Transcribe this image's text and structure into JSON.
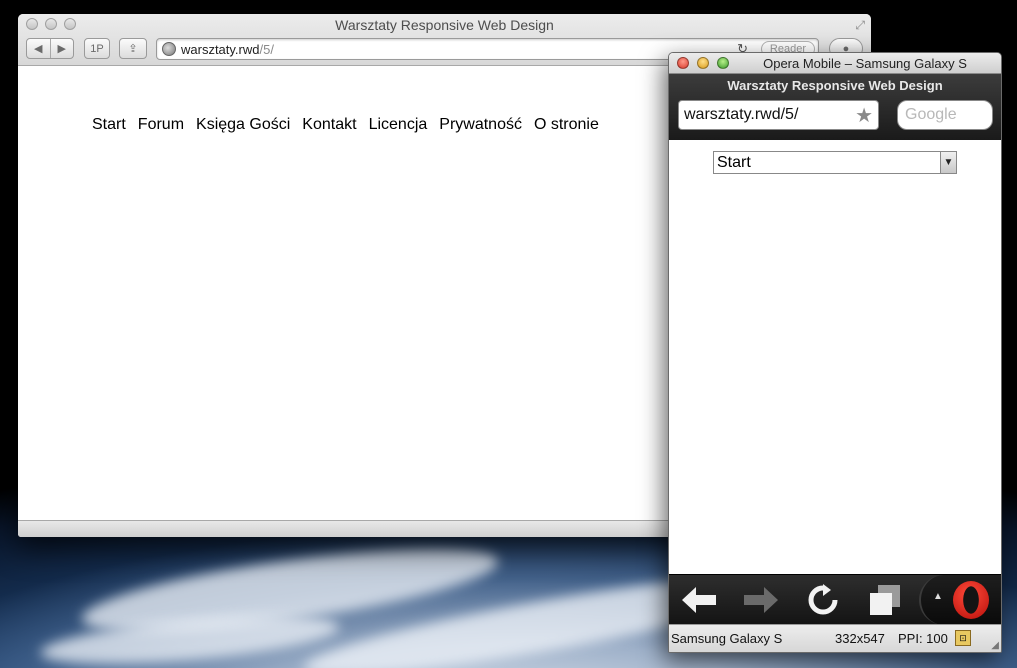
{
  "desktop": {
    "wallpaper": "earth-from-orbit"
  },
  "safari": {
    "title": "Warsztaty Responsive Web Design",
    "toolbar": {
      "back_icon": "back-arrow-icon",
      "forward_icon": "forward-arrow-icon",
      "onepassword_label": "1P",
      "share_icon": "share-icon",
      "address_host": "warsztaty.rwd",
      "address_path": "/5/",
      "reload_icon": "reload-icon",
      "reader_label": "Reader"
    },
    "nav_items": [
      "Start",
      "Forum",
      "Księga Gości",
      "Kontakt",
      "Licencja",
      "Prywatność",
      "O stronie"
    ]
  },
  "opera_mobile": {
    "window_title": "Opera Mobile – Samsung Galaxy S",
    "page_title": "Warsztaty Responsive Web Design",
    "address": "warsztaty.rwd/5/",
    "search_placeholder": "Google",
    "nav_select_value": "Start",
    "toolbar": {
      "back_icon": "back-arrow-icon",
      "forward_icon": "forward-arrow-icon",
      "reload_icon": "reload-icon",
      "tabs_icon": "tabs-icon",
      "menu_icon": "opera-logo-icon"
    },
    "status": {
      "device": "Samsung Galaxy S",
      "resolution": "332x547",
      "ppi": "PPI: 100"
    }
  },
  "colors": {
    "opera_red": "#d8281e",
    "dark_toolbar": "#1a1a1a"
  }
}
